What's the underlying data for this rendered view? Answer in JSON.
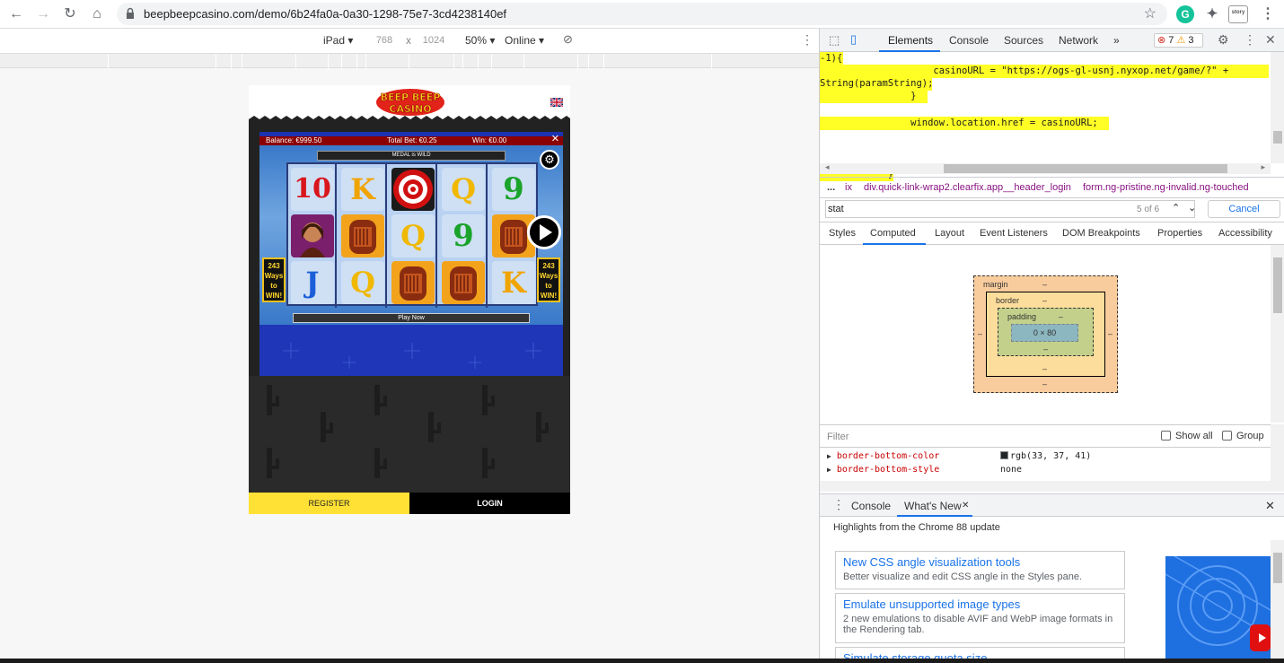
{
  "browser": {
    "url": "beepbeepcasino.com/demo/6b24fa0a-0a30-1298-75e7-3cd4238140ef",
    "ext_story_label": "story"
  },
  "device_toolbar": {
    "device": "iPad",
    "width": "768",
    "times": "x",
    "height": "1024",
    "zoom": "50%",
    "network": "Online"
  },
  "casino": {
    "logo_line1": "BEEP BEEP",
    "logo_line2": "CASINO",
    "status": {
      "balance": "Balance: €999.50",
      "total_bet": "Total Bet: €0.25",
      "win": "Win: €0.00"
    },
    "medal_label": "MEDAL is WILD",
    "ways_line1": "243",
    "ways_line2": "Ways",
    "ways_line3": "to",
    "ways_line4": "WIN!",
    "play_now": "Play Now",
    "register": "REGISTER",
    "login": "LOGIN",
    "reels": [
      [
        "10",
        "",
        "J"
      ],
      [
        "K",
        "",
        "Q"
      ],
      [
        "",
        "Q",
        ""
      ],
      [
        "Q",
        "9",
        ""
      ],
      [
        "9",
        "",
        "K"
      ]
    ]
  },
  "devtools": {
    "tabs": [
      "Elements",
      "Console",
      "Sources",
      "Network"
    ],
    "more_tabs": "»",
    "errors": "7",
    "warnings": "3",
    "code_lines": [
      "-1){",
      "                    casinoURL = \"https://ogs-gl-usnj.nyxop.net/game/?\" +",
      "String(paramString);",
      "                }",
      "",
      "                window.location.href = casinoURL;",
      "",
      "            }"
    ],
    "breadcrumbs": [
      "...",
      "ix",
      "div.quick-link-wrap2.clearfix.app__header_login",
      "form.ng-pristine.ng-invalid.ng-touched"
    ],
    "search": {
      "value": "stat",
      "count": "5 of 6",
      "cancel": "Cancel"
    },
    "sub_tabs": [
      "Styles",
      "Computed",
      "Layout",
      "Event Listeners",
      "DOM Breakpoints",
      "Properties",
      "Accessibility"
    ],
    "box_model": {
      "margin": "margin",
      "border": "border",
      "padding": "padding",
      "content": "0 × 80",
      "dash": "–"
    },
    "filter": {
      "placeholder": "Filter",
      "show_all": "Show all",
      "group": "Group"
    },
    "properties": [
      {
        "name": "border-bottom-color",
        "value": "rgb(33, 37, 41)"
      },
      {
        "name": "border-bottom-style",
        "value": "none"
      }
    ],
    "drawer_tabs": [
      "Console",
      "What's New"
    ],
    "highlights": "Highlights from the Chrome 88 update",
    "news": [
      {
        "title": "New CSS angle visualization tools",
        "desc": "Better visualize and edit CSS angle in the Styles pane."
      },
      {
        "title": "Emulate unsupported image types",
        "desc": "2 new emulations to disable AVIF and WebP image formats in the Rendering tab."
      },
      {
        "title": "Simulate storage quota size",
        "desc": ""
      }
    ]
  }
}
